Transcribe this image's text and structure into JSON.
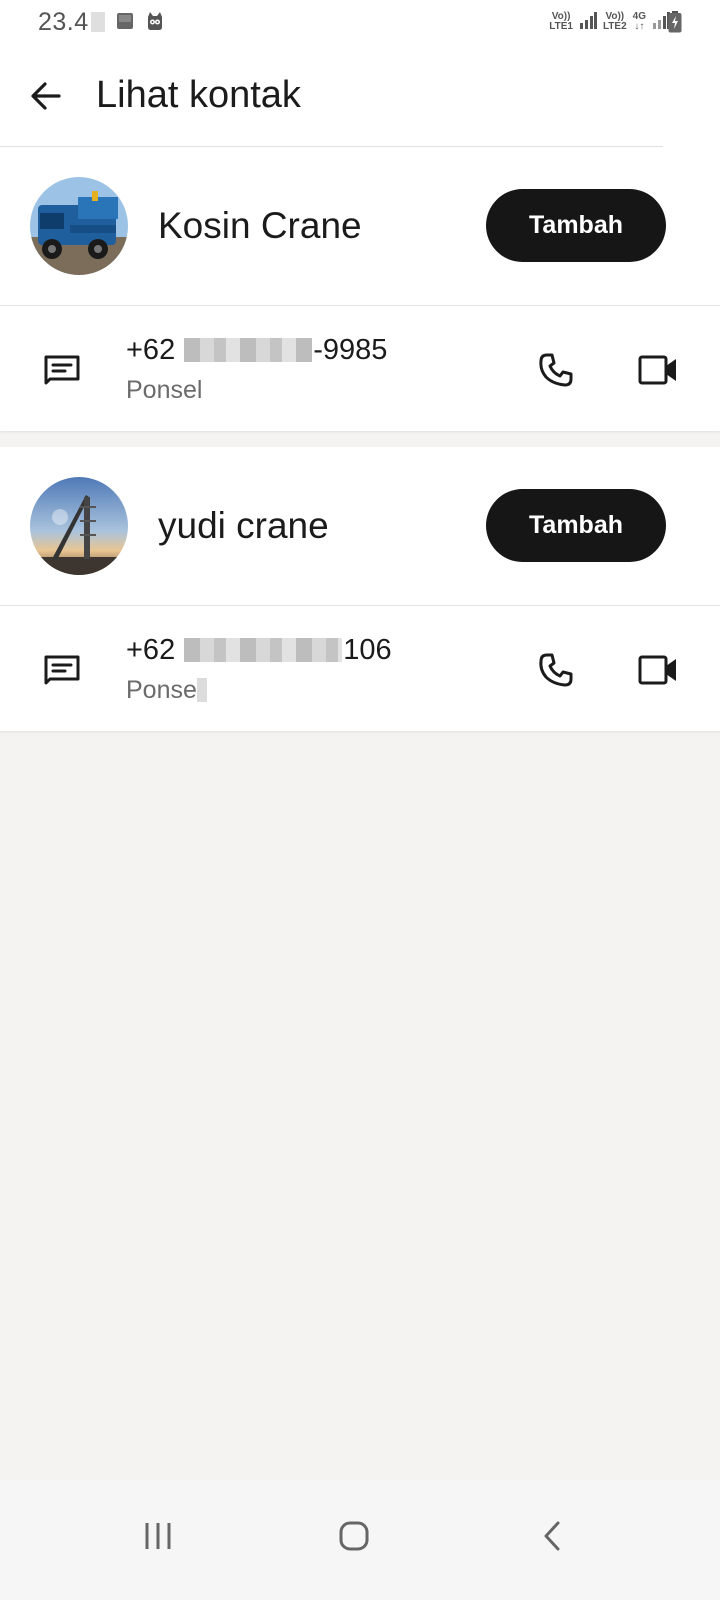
{
  "status_bar": {
    "time": "23.4",
    "net1_top": "Vo))",
    "net1_bottom": "LTE1",
    "net2_top": "Vo))",
    "net2_bottom": "LTE2",
    "net3_top": "4G",
    "icons": [
      "gallery-icon",
      "cat-icon",
      "signal-icon",
      "battery-icon"
    ]
  },
  "app_bar": {
    "title": "Lihat kontak",
    "back_icon": "arrow-left-icon"
  },
  "contacts": [
    {
      "name": "Kosin Crane",
      "add_label": "Tambah",
      "phone_prefix": "+62",
      "phone_suffix": "-9985",
      "phone_type": "Ponsel",
      "avatar": "crane-truck-photo"
    },
    {
      "name": "yudi crane",
      "add_label": "Tambah",
      "phone_prefix": "+62",
      "phone_suffix": "106",
      "phone_type": "Ponse",
      "avatar": "tower-crane-photo"
    }
  ],
  "row_icons": [
    "message-icon",
    "phone-icon",
    "video-call-icon"
  ],
  "nav_bar": {
    "icons": [
      "recents-icon",
      "home-icon",
      "back-icon"
    ]
  },
  "colors": {
    "background": "#f4f3f2",
    "card": "#ffffff",
    "button": "#161616",
    "button_text": "#ffffff",
    "secondary_text": "#6b6b6b"
  }
}
